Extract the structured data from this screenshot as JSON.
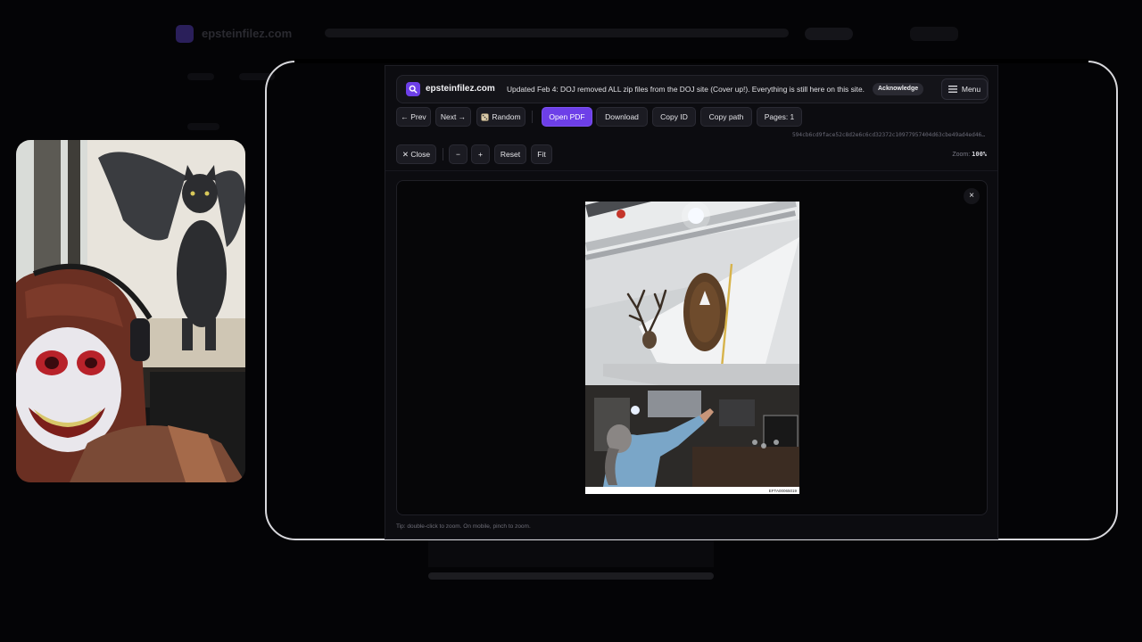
{
  "background": {
    "site_name": "epsteinfilez.com"
  },
  "header": {
    "site_name": "epsteinfilez.com",
    "notice": "Updated Feb 4: DOJ removed ALL zip files from the DOJ site (Cover up!). Everything is still here on this site.",
    "acknowledge_label": "Acknowledge",
    "menu_label": "Menu"
  },
  "toolbar": {
    "prev_label": "← Prev",
    "next_label": "Next →",
    "random_label": "Random",
    "open_pdf_label": "Open PDF",
    "download_label": "Download",
    "copy_id_label": "Copy ID",
    "copy_path_label": "Copy path",
    "pages_label": "Pages: 1",
    "hash": "594cb6cd9face52c8d2e6c6cd32372c10977957404d63cbe49ad4ed46…"
  },
  "zoom_controls": {
    "close_label": "✕ Close",
    "zoom_out_label": "−",
    "zoom_in_label": "+",
    "reset_label": "Reset",
    "fit_label": "Fit",
    "zoom_prefix": "Zoom:",
    "zoom_value": "100%"
  },
  "viewer": {
    "close_glyph": "×",
    "document_stamp": "EFTA00065019"
  },
  "footer": {
    "tip": "Tip: double-click to zoom. On mobile, pinch to zoom."
  },
  "icons": {
    "logo": "search-icon",
    "menu": "hamburger-icon",
    "random": "dice-icon"
  },
  "colors": {
    "accent": "#6d3fe8",
    "modal_bg": "#0c0c10",
    "frame": "#d8d8dc"
  }
}
